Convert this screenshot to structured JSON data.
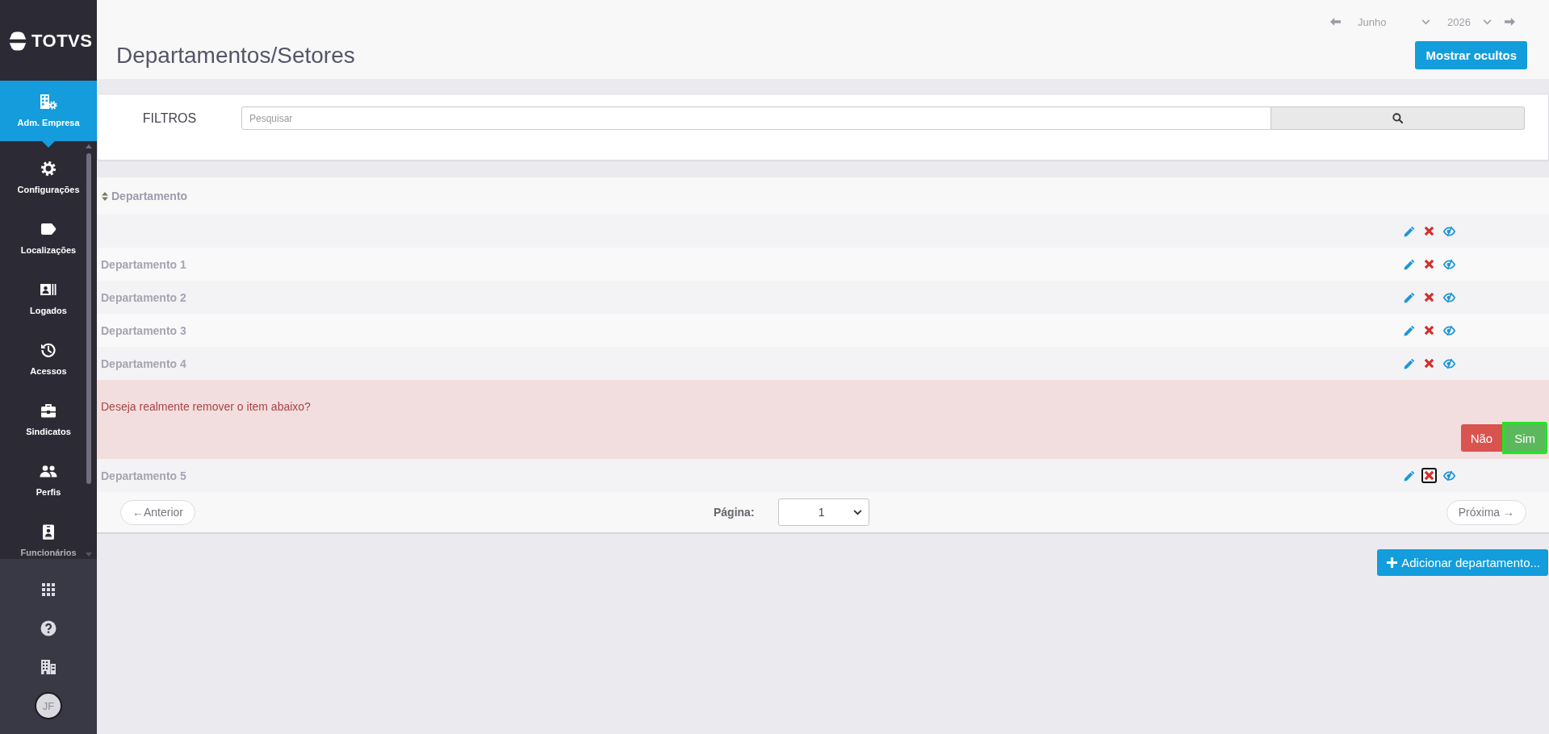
{
  "sidebar": {
    "logo": "TOTVS",
    "items": [
      {
        "label": "Adm. Empresa",
        "selected": true
      },
      {
        "label": "Configurações",
        "selected": false
      },
      {
        "label": "Localizações",
        "selected": false
      },
      {
        "label": "Logados",
        "selected": false
      },
      {
        "label": "Acessos",
        "selected": false
      },
      {
        "label": "Sindicatos",
        "selected": false
      },
      {
        "label": "Perfis",
        "selected": false
      },
      {
        "label": "Funcionários",
        "selected": false
      }
    ],
    "user": {
      "initials": "JF"
    }
  },
  "header": {
    "title": "Departamentos/Setores",
    "period": {
      "month": "Junho",
      "year": "2026"
    },
    "button": "Mostrar ocultos"
  },
  "filters": {
    "label": "FILTROS",
    "search": {
      "placeholder": "Pesquisar"
    }
  },
  "table": {
    "columns": [
      "Departamento"
    ],
    "rows": [
      {
        "kind": "item",
        "delete_focused": false
      },
      {
        "kind": "item",
        "name": "Departamento 1",
        "delete_focused": false
      },
      {
        "kind": "item",
        "name": "Departamento 2",
        "delete_focused": false
      },
      {
        "kind": "item",
        "name": "Departamento 3",
        "delete_focused": false
      },
      {
        "kind": "item",
        "name": "Departamento 4",
        "delete_focused": false
      },
      {
        "kind": "confirm",
        "message": "Deseja realmente remover o item abaixo?",
        "buttons": [
          {
            "label": "Não",
            "kind": "cancel",
            "focused": false
          },
          {
            "label": "Sim",
            "kind": "confirm",
            "focused": true
          }
        ]
      },
      {
        "kind": "item",
        "name": "Departamento 5",
        "delete_focused": true
      }
    ]
  },
  "pagination": {
    "previous": "←Anterior",
    "page_label": "Página:",
    "page": "1",
    "next": "Próxima →"
  },
  "add_button": "Adicionar departamento..."
}
